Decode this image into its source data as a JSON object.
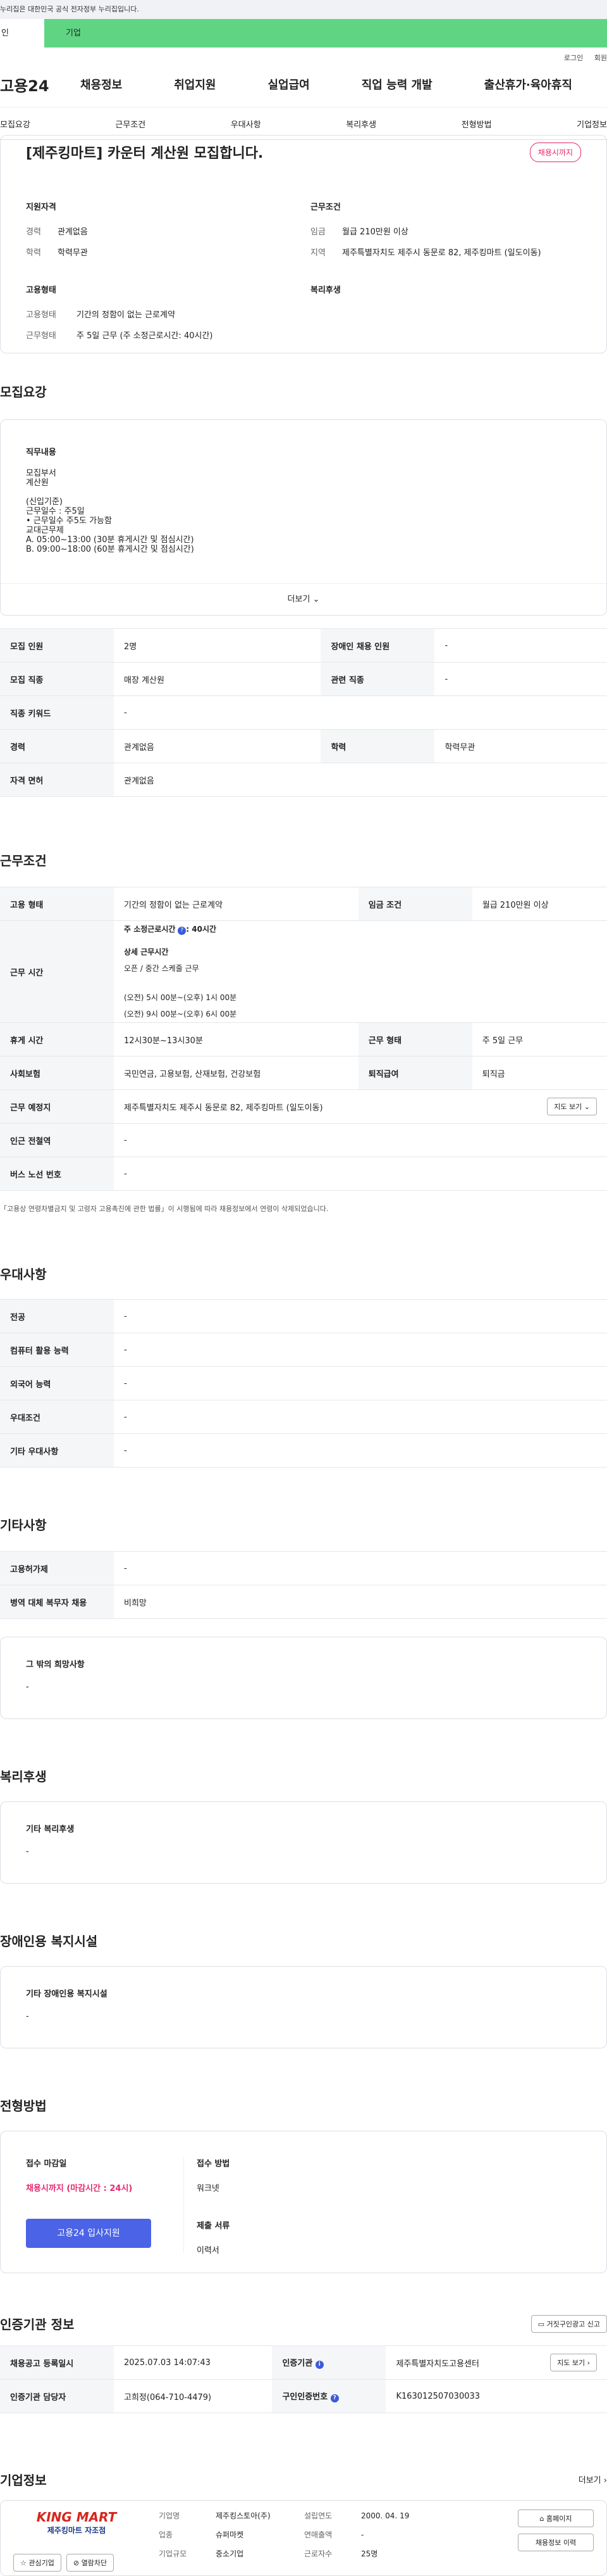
{
  "gov_banner": "누리집은 대한민국 공식 전자정부 누리집입니다.",
  "switcher": {
    "personal": "인",
    "company": "기업"
  },
  "util": [
    "로그인",
    "회원"
  ],
  "logo": "고용24",
  "gnb": [
    "채용정보",
    "취업지원",
    "실업급여",
    "직업 능력 개발",
    "출산휴가·육아휴직"
  ],
  "lnb": [
    "모집요강",
    "근무조건",
    "우대사항",
    "복리후생",
    "전형방법",
    "기업정보"
  ],
  "summary": {
    "title": "[제주킹마트] 카운터 계산원 모집합니다.",
    "badge": "채용시까지",
    "q_title": "지원자격",
    "q": [
      {
        "k": "경력",
        "v": "관계없음"
      },
      {
        "k": "학력",
        "v": "학력무관"
      }
    ],
    "w_title": "근무조건",
    "w": [
      {
        "k": "임금",
        "v": "월급 210만원 이상"
      },
      {
        "k": "지역",
        "v": "제주특별자치도 제주시 동문로 82, 제주킹마트 (일도이동)"
      }
    ],
    "e_title": "고용형태",
    "e": [
      {
        "k": "고용형태",
        "v": "기간의 정함이 없는 근로계약"
      },
      {
        "k": "근무형태",
        "v": "주 5일 근무 (주 소정근로시간: 40시간)"
      }
    ],
    "b_title": "복리후생"
  },
  "recruit": {
    "title": "모집요강",
    "job_label": "직무내용",
    "lines": [
      "모집부서",
      "계산원",
      "",
      "(신입기준)",
      "근무일수 : 주5일",
      "• 근무일수 주5도 가능함",
      "교대근무제",
      "A. 05:00~13:00 (30분 휴게시간 및 점심시간)",
      "B. 09:00~18:00 (60분 휴게시간 및 점심시간)"
    ],
    "more": "더보기",
    "rows": [
      [
        "모집 인원",
        "2명",
        "장애인 채용 인원",
        "-"
      ],
      [
        "모집 직종",
        "매장 계산원",
        "관련 직종",
        "-"
      ],
      [
        "직종 키워드",
        "-",
        "",
        ""
      ],
      [
        "경력",
        "관계없음",
        "학력",
        "학력무관"
      ],
      [
        "자격 면허",
        "관계없음",
        "",
        ""
      ]
    ]
  },
  "cond": {
    "title": "근무조건",
    "r1": [
      "고용 형태",
      "기간의 정함이 없는 근로계약",
      "임금 조건",
      "월급 210만원 이상"
    ],
    "hours_label": "근무 시간",
    "hours_main": "주 소정근로시간",
    "hours_val": ": 40시간",
    "hours_sub": "상세 근무시간",
    "hours_shift": "오픈 / 중간 스케줄 근무",
    "hours_a": "(오전) 5시 00분~(오후) 1시 00분",
    "hours_b": "(오전) 9시 00분~(오후) 6시 00분",
    "r2": [
      "휴게 시간",
      "12시30분~13시30분",
      "근무 형태",
      "주 5일 근무"
    ],
    "r3": [
      "사회보험",
      "국민연금, 고용보험, 산재보험, 건강보험",
      "퇴직급여",
      "퇴직금"
    ],
    "place_label": "근무 예정지",
    "place": "제주특별자치도 제주시 동문로 82, 제주킹마트 (일도이동)",
    "map": "지도 보기",
    "r4": [
      "인근 전철역",
      "-"
    ],
    "r5": [
      "버스 노선 번호",
      "-"
    ],
    "note": "「고용상 연령차별금지 및 고령자 고용촉진에 관한 법률」이 시행됨에 따라 채용정보에서 연령이 삭제되었습니다."
  },
  "pref": {
    "title": "우대사항",
    "rows": [
      [
        "전공",
        "-"
      ],
      [
        "컴퓨터 활용 능력",
        "-"
      ],
      [
        "외국어 능력",
        "-"
      ],
      [
        "우대조건",
        "-"
      ],
      [
        "기타 우대사항",
        "-"
      ]
    ]
  },
  "etc": {
    "title": "기타사항",
    "rows": [
      [
        "고용허가제",
        "-"
      ],
      [
        "병역 대체 복무자 채용",
        "비희망"
      ]
    ],
    "box_title": "그 밖의 희망사항",
    "box_val": "-"
  },
  "welfare": {
    "title": "복리후생",
    "box_title": "기타 복리후생",
    "box_val": "-"
  },
  "disab": {
    "title": "장애인용 복지시설",
    "box_title": "기타 장애인용 복지시설",
    "box_val": "-"
  },
  "process": {
    "title": "전형방법",
    "deadline_label": "접수 마감일",
    "deadline": "채용시까지 (마감시간 : 24시)",
    "apply": "고용24 입사지원",
    "method_label": "접수 방법",
    "method": "워크넷",
    "docs_label": "제출 서류",
    "docs": "이력서"
  },
  "cert": {
    "title": "인증기관 정보",
    "report": "거짓구인광고 신고",
    "rows": [
      [
        "채용공고 등록일시",
        "2025.07.03 14:07:43",
        "인증기관",
        "제주특별자치도고용센터"
      ],
      [
        "인증기관 담당자",
        "고희정(064-710-4479)",
        "구인인증번호",
        "K163012507030033"
      ]
    ],
    "map": "지도 보기"
  },
  "company": {
    "title": "기업정보",
    "more": "더보기",
    "logo_text": "KING MART",
    "logo_sub": "제주킹마트 자조점",
    "fav": "관심기업",
    "block": "열람차단",
    "name_k": "기업명",
    "name": "제주킹스토아(주)",
    "ind_k": "업종",
    "ind": "슈퍼마켓",
    "size_k": "기업규모",
    "size": "중소기업",
    "est_k": "설립연도",
    "est": "2000. 04. 19",
    "rev_k": "연매출액",
    "rev": "-",
    "emp_k": "근로자수",
    "emp": "25명",
    "home": "홈페이지",
    "hist": "채용정보 이력"
  }
}
